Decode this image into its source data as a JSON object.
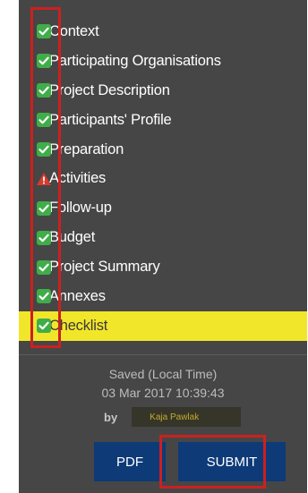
{
  "nav": {
    "items": [
      {
        "label": "Context",
        "status": "complete"
      },
      {
        "label": "Participating Organisations",
        "status": "complete"
      },
      {
        "label": "Project Description",
        "status": "complete"
      },
      {
        "label": "Participants' Profile",
        "status": "complete"
      },
      {
        "label": "Preparation",
        "status": "complete"
      },
      {
        "label": "Activities",
        "status": "warning"
      },
      {
        "label": "Follow-up",
        "status": "complete"
      },
      {
        "label": "Budget",
        "status": "complete"
      },
      {
        "label": "Project Summary",
        "status": "complete"
      },
      {
        "label": "Annexes",
        "status": "complete"
      },
      {
        "label": "Checklist",
        "status": "complete",
        "active": true
      }
    ]
  },
  "saved": {
    "label": "Saved (Local Time)",
    "datetime": "03 Mar 2017 10:39:43",
    "by_label": "by",
    "user": "Kaja Pawlak"
  },
  "buttons": {
    "pdf": "PDF",
    "submit": "SUBMIT"
  },
  "colors": {
    "panel_bg": "#464646",
    "complete_green": "#3fae49",
    "warning_red": "#d93a2b",
    "active_yellow": "#f2e62a",
    "button_blue": "#0e3a78",
    "highlight_red": "#cc2020"
  },
  "icons": {
    "complete": "check-icon",
    "warning": "warning-icon"
  }
}
